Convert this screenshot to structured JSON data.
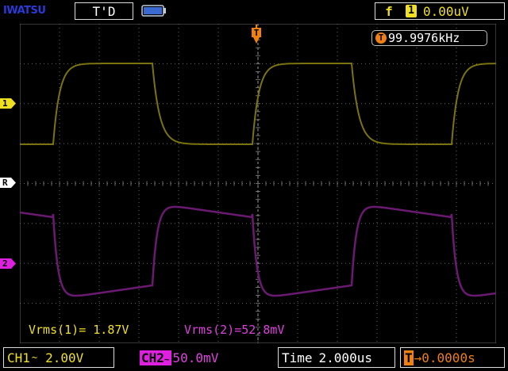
{
  "header": {
    "brand": "IWATSU",
    "trigger_mode": "T'D",
    "trigger_edge_symbol": "f",
    "trigger_source": "1",
    "trigger_level": "0.00uV"
  },
  "frequency": {
    "badge": "T",
    "value": "99.9976kHz"
  },
  "channel_markers": {
    "ch1": "1",
    "ref": "R",
    "ch2": "2"
  },
  "measurements": {
    "vrms1": "Vrms(1)= 1.87V",
    "vrms2": "Vrms(2)=52.8mV"
  },
  "footer": {
    "ch1_label": "CH1",
    "ch1_coupling": "~",
    "ch1_scale": "2.00V",
    "ch2_label": "CH2",
    "ch2_coupling": "~",
    "ch2_scale": "50.0mV",
    "time_label": "Time",
    "timebase": "2.000us",
    "delay_badge": "T",
    "delay": "→0.0000s"
  },
  "colors": {
    "ch1": "#f0e020",
    "ch1_trace": "#7a7410",
    "ch2": "#e020e0",
    "ch2_trace": "#6a1a70",
    "trigger": "#f08010",
    "grid": "#6a6a6a"
  }
}
